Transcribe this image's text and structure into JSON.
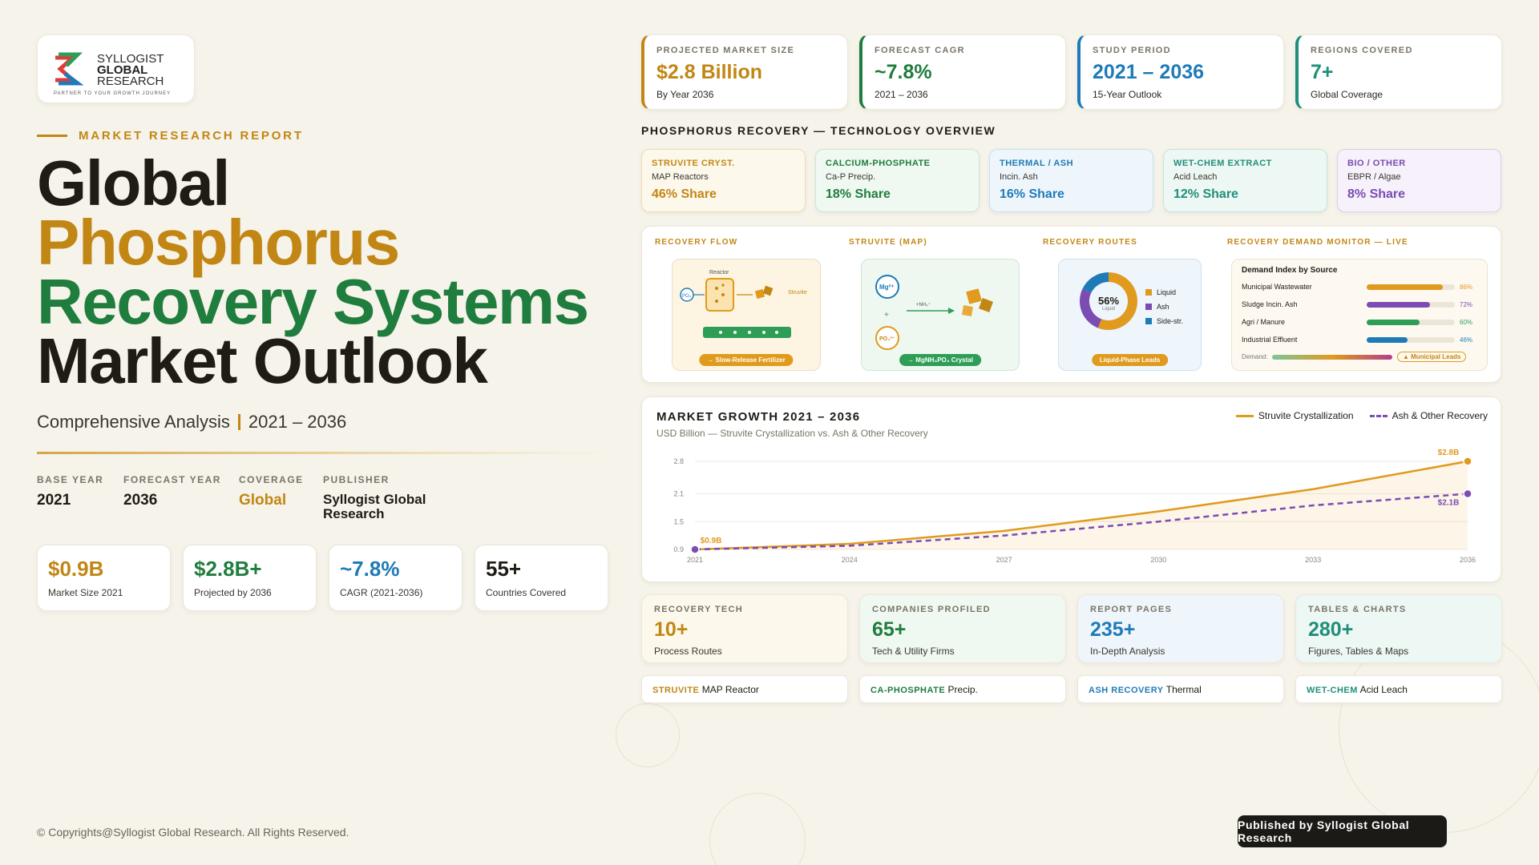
{
  "logo": {
    "line1": "SYLLOGIST",
    "line2": "GLOBAL",
    "line3": "RESEARCH",
    "tagline": "PARTNER TO YOUR GROWTH JOURNEY"
  },
  "eyebrow": "MARKET RESEARCH REPORT",
  "title": {
    "line1": "Global",
    "line2": "Phosphorus",
    "line3": "Recovery Systems",
    "line4": "Market Outlook"
  },
  "subtitle": {
    "text": "Comprehensive Analysis",
    "period": "2021 – 2036"
  },
  "meta": [
    {
      "key": "BASE YEAR",
      "value": "2021"
    },
    {
      "key": "FORECAST YEAR",
      "value": "2036"
    },
    {
      "key": "COVERAGE",
      "value": "Global"
    },
    {
      "key": "PUBLISHER",
      "value": "Syllogist Global Research"
    }
  ],
  "stats": [
    {
      "big": "$0.9B",
      "small": "Market Size 2021"
    },
    {
      "big": "$2.8B+",
      "small": "Projected by 2036"
    },
    {
      "big": "~7.8%",
      "small": "CAGR (2021-2036)"
    },
    {
      "big": "55+",
      "small": "Countries Covered"
    }
  ],
  "kpis": [
    {
      "label": "PROJECTED MARKET SIZE",
      "big": "$2.8 Billion",
      "small": "By Year 2036"
    },
    {
      "label": "FORECAST CAGR",
      "big": "~7.8%",
      "small": "2021 – 2036"
    },
    {
      "label": "STUDY PERIOD",
      "big": "2021 – 2036",
      "small": "15-Year Outlook"
    },
    {
      "label": "REGIONS COVERED",
      "big": "7+",
      "small": "Global Coverage"
    }
  ],
  "tech_heading": "PHOSPHORUS RECOVERY — TECHNOLOGY OVERVIEW",
  "tech": [
    {
      "name": "STRUVITE CRYST.",
      "sub": "MAP Reactors",
      "share": "46% Share",
      "color": "#c28614"
    },
    {
      "name": "CALCIUM-PHOSPHATE",
      "sub": "Ca-P Precip.",
      "share": "18% Share",
      "color": "#1f7d3d"
    },
    {
      "name": "THERMAL / ASH",
      "sub": "Incin. Ash",
      "share": "16% Share",
      "color": "#1f7bb8"
    },
    {
      "name": "WET-CHEM EXTRACT",
      "sub": "Acid Leach",
      "share": "12% Share",
      "color": "#1f8f7a"
    },
    {
      "name": "BIO / OTHER",
      "sub": "EBPR / Algae",
      "share": "8% Share",
      "color": "#7b4cb2"
    }
  ],
  "flow": {
    "recovery_flow": {
      "title": "RECOVERY FLOW",
      "reactor": "Reactor",
      "input": "PO₄",
      "output": "Struvite",
      "pill": "→ Slow-Release Fertilizer"
    },
    "struvite": {
      "title": "STRUVITE (MAP)",
      "mg": "Mg²⁺",
      "po": "PO₄³⁻",
      "plus": "+",
      "nh": "+NH₄⁺",
      "pill": "→ MgNH₄PO₄ Crystal"
    },
    "routes": {
      "title": "RECOVERY ROUTES",
      "center": "56%",
      "center_sub": "Liquid",
      "legend": [
        "Liquid",
        "Ash",
        "Side-str."
      ],
      "pill": "Liquid-Phase Leads",
      "values": [
        56,
        26,
        18
      ]
    },
    "monitor": {
      "title": "RECOVERY DEMAND MONITOR — LIVE",
      "heading": "Demand Index by Source",
      "rows": [
        {
          "name": "Municipal Wastewater",
          "label": "86%",
          "value": 86,
          "color": "#e09a1e"
        },
        {
          "name": "Sludge Incin. Ash",
          "label": "72%",
          "value": 72,
          "color": "#7b4cb2"
        },
        {
          "name": "Agri / Manure",
          "label": "60%",
          "value": 60,
          "color": "#2e9e57"
        },
        {
          "name": "Industrial Effluent",
          "label": "46%",
          "value": 46,
          "color": "#1f7bb8"
        }
      ],
      "demand_label": "Demand:",
      "badge": "▲ Municipal Leads"
    }
  },
  "chart": {
    "title": "MARKET GROWTH 2021 – 2036",
    "subtitle": "USD Billion — Struvite Crystallization vs. Ash & Other Recovery"
  },
  "chart_data": {
    "type": "line",
    "x": [
      2021,
      2024,
      2027,
      2030,
      2033,
      2036
    ],
    "series": [
      {
        "name": "Struvite Crystallization",
        "values": [
          0.9,
          1.02,
          1.3,
          1.72,
          2.2,
          2.8
        ],
        "color": "#e09a1e",
        "dash": false
      },
      {
        "name": "Ash & Other Recovery",
        "values": [
          0.9,
          0.98,
          1.2,
          1.5,
          1.85,
          2.1
        ],
        "color": "#7b4cb2",
        "dash": true
      }
    ],
    "yticks": [
      "2.8",
      "2.1",
      "1.5",
      "0.9"
    ],
    "ytick_values": [
      2.8,
      2.1,
      1.5,
      0.9
    ],
    "ylim": [
      0.9,
      2.8
    ],
    "annotations": [
      {
        "series": 0,
        "index": 0,
        "text": "$0.9B"
      },
      {
        "series": 0,
        "index": 5,
        "text": "$2.8B"
      },
      {
        "series": 1,
        "index": 5,
        "text": "$2.1B"
      }
    ]
  },
  "bottom": [
    {
      "label": "RECOVERY TECH",
      "big": "10+",
      "small": "Process Routes",
      "color": "#c28614"
    },
    {
      "label": "COMPANIES PROFILED",
      "big": "65+",
      "small": "Tech & Utility Firms",
      "color": "#1f7d3d"
    },
    {
      "label": "REPORT PAGES",
      "big": "235+",
      "small": "In-Depth Analysis",
      "color": "#1f7bb8"
    },
    {
      "label": "TABLES & CHARTS",
      "big": "280+",
      "small": "Figures, Tables & Maps",
      "color": "#1f8f7a"
    }
  ],
  "tags": [
    {
      "tag": "STRUVITE",
      "text": "MAP Reactor"
    },
    {
      "tag": "CA-PHOSPHATE",
      "text": "Precip."
    },
    {
      "tag": "ASH RECOVERY",
      "text": "Thermal"
    },
    {
      "tag": "WET-CHEM",
      "text": "Acid Leach"
    }
  ],
  "footer": "© Copyrights@Syllogist Global Research. All Rights Reserved.",
  "published": "Published by Syllogist Global Research"
}
